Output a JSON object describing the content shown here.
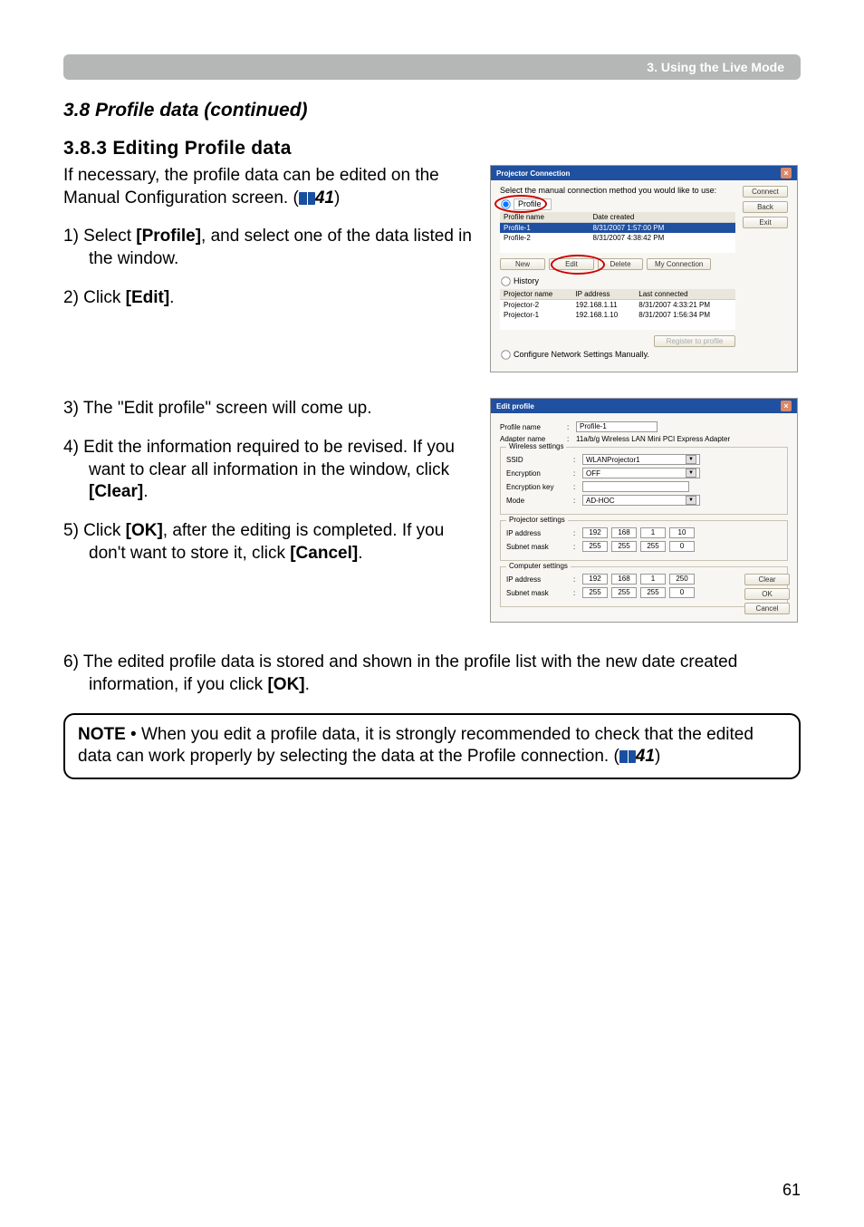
{
  "header": {
    "chapter": "3. Using the Live Mode"
  },
  "section": {
    "title": "3.8 Profile data (continued)"
  },
  "subsection": {
    "title": "3.8.3 Editing Profile data"
  },
  "intro": {
    "line1": "If necessary, the profile data can be edited on the Manual Configuration screen. (",
    "ref": "41",
    "line2": ")"
  },
  "steps": {
    "s1a": "1) Select ",
    "s1b": "[Profile]",
    "s1c": ", and select one of the data listed in the window.",
    "s2a": "2) Click ",
    "s2b": "[Edit]",
    "s2c": ".",
    "s3": "3) The \"Edit profile\" screen will come up.",
    "s4a": "4) Edit the information required to be revised. If you want to clear all information in the window, click ",
    "s4b": "[Clear]",
    "s4c": ".",
    "s5a": "5) Click ",
    "s5b": "[OK]",
    "s5c": ", after the editing is completed. If you don't want to store it, click ",
    "s5d": "[Cancel]",
    "s5e": ".",
    "s6a": "6) The edited profile data is stored and shown in the profile list with the new date created information, if you click ",
    "s6b": "[OK]",
    "s6c": "."
  },
  "note": {
    "label": "NOTE",
    "text1": " • When you edit a profile data, it is strongly recommended to check that the edited data can work properly by selecting the data at the Profile connection. (",
    "ref": "41",
    "text2": ")"
  },
  "page_number": "61",
  "fig1": {
    "title": "Projector Connection",
    "instr": "Select the manual connection method you would like to use:",
    "radio_profile": "Profile",
    "radio_history": "History",
    "radio_manual": "Configure Network Settings Manually.",
    "cols": {
      "name": "Profile name",
      "date": "Date created"
    },
    "rows": [
      {
        "name": "Profile-1",
        "date": "8/31/2007 1:57:00 PM"
      },
      {
        "name": "Profile-2",
        "date": "8/31/2007 4:38:42 PM"
      }
    ],
    "btns": {
      "new": "New",
      "edit": "Edit",
      "delete": "Delete",
      "myconn": "My Connection"
    },
    "hist_cols": {
      "name": "Projector name",
      "ip": "IP address",
      "last": "Last connected"
    },
    "hist_rows": [
      {
        "name": "Projector-2",
        "ip": "192.168.1.11",
        "last": "8/31/2007 4:33:21 PM"
      },
      {
        "name": "Projector-1",
        "ip": "192.168.1.10",
        "last": "8/31/2007 1:56:34 PM"
      }
    ],
    "register": "Register to profile",
    "side": {
      "connect": "Connect",
      "back": "Back",
      "exit": "Exit"
    }
  },
  "fig2": {
    "title": "Edit profile",
    "profile_name_label": "Profile name",
    "profile_name_value": "Profile-1",
    "adapter_label": "Adapter name",
    "adapter_value": "11a/b/g Wireless LAN Mini PCI Express Adapter",
    "wireless_legend": "Wireless settings",
    "ssid_label": "SSID",
    "ssid_value": "WLANProjector1",
    "enc_label": "Encryption",
    "enc_value": "OFF",
    "enckey_label": "Encryption key",
    "enckey_value": "",
    "mode_label": "Mode",
    "mode_value": "AD-HOC",
    "proj_legend": "Projector settings",
    "ip_label": "IP address",
    "subnet_label": "Subnet mask",
    "proj_ip": [
      "192",
      "168",
      "1",
      "10"
    ],
    "proj_mask": [
      "255",
      "255",
      "255",
      "0"
    ],
    "comp_legend": "Computer settings",
    "comp_ip": [
      "192",
      "168",
      "1",
      "250"
    ],
    "comp_mask": [
      "255",
      "255",
      "255",
      "0"
    ],
    "btns": {
      "clear": "Clear",
      "ok": "OK",
      "cancel": "Cancel"
    }
  }
}
